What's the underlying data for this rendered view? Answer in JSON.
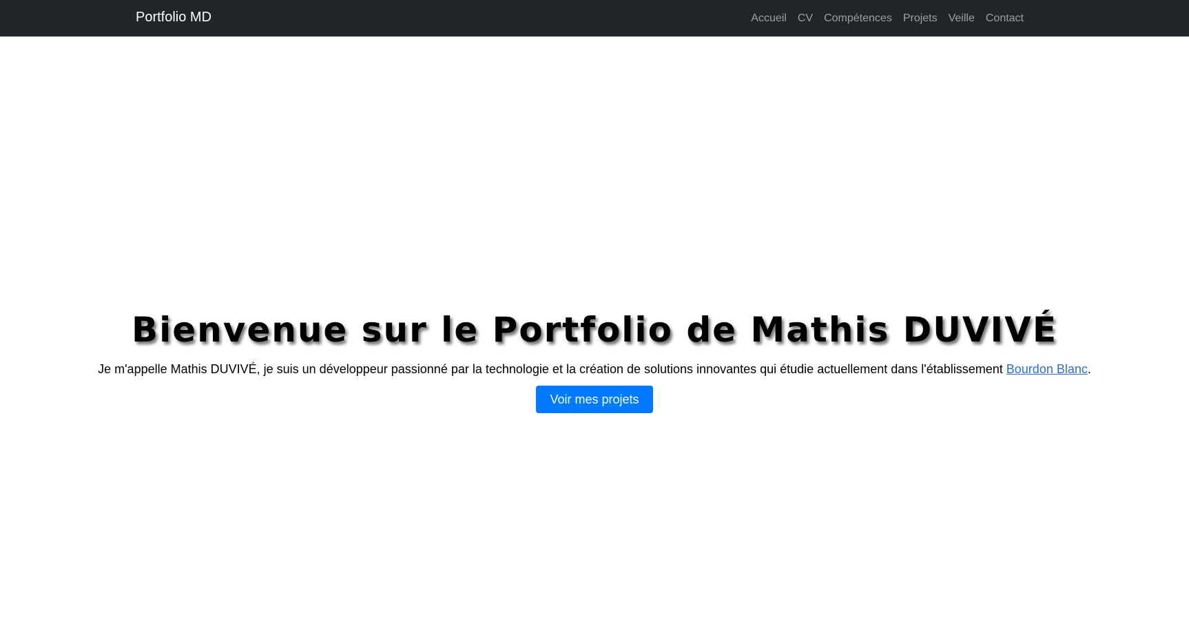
{
  "navbar": {
    "brand": "Portfolio MD",
    "links": [
      "Accueil",
      "CV",
      "Compétences",
      "Projets",
      "Veille",
      "Contact"
    ]
  },
  "hero": {
    "title": "Bienvenue sur le Portfolio de Mathis DUVIVÉ",
    "intro_before": "Je m'appelle Mathis DUVIVÉ, je suis un développeur passionné par la technologie et la création de solutions innovantes qui étudie actuellement dans l'établissement ",
    "intro_link": "Bourdon Blanc",
    "intro_after": ".",
    "button": "Voir mes projets"
  },
  "colors": {
    "navbar_bg": "#212529",
    "accent": "#007bff",
    "link": "#2f6fd0"
  }
}
